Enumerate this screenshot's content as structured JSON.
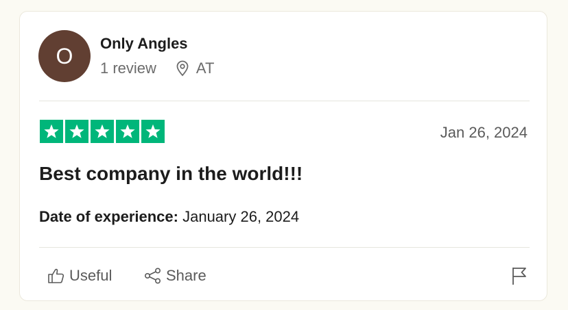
{
  "review": {
    "avatar_initial": "O",
    "author_name": "Only Angles",
    "review_count": "1 review",
    "location": "AT",
    "rating": 5,
    "rating_max": 5,
    "published_date": "Jan 26, 2024",
    "title": "Best company in the world!!!",
    "experience_label": "Date of experience:",
    "experience_date": "January 26, 2024"
  },
  "actions": {
    "useful_label": "Useful",
    "share_label": "Share"
  },
  "icons": {
    "location": "location-pin-icon",
    "useful": "thumbs-up-icon",
    "share": "share-icon",
    "flag": "flag-icon",
    "star": "star-icon"
  },
  "colors": {
    "star_green": "#00b67a",
    "avatar_bg": "#613f32",
    "page_bg": "#fbfaf3"
  }
}
